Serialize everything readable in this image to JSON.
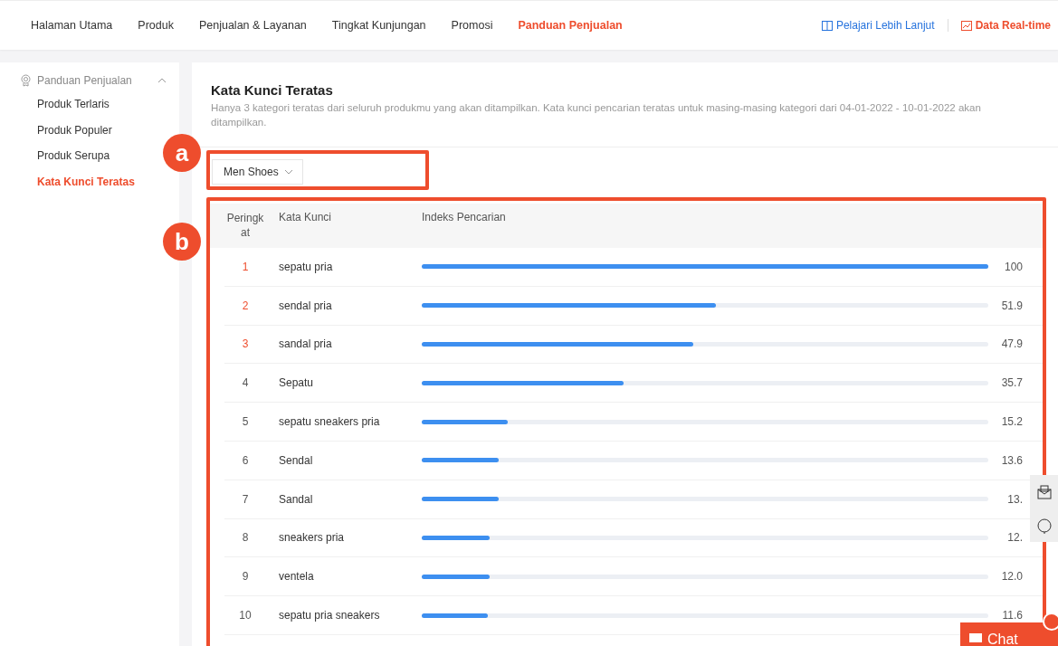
{
  "nav": {
    "items": [
      {
        "label": "Halaman Utama",
        "selected": false
      },
      {
        "label": "Produk",
        "selected": false
      },
      {
        "label": "Penjualan & Layanan",
        "selected": false
      },
      {
        "label": "Tingkat Kunjungan",
        "selected": false
      },
      {
        "label": "Promosi",
        "selected": false
      },
      {
        "label": "Panduan Penjualan",
        "selected": true
      }
    ],
    "links": [
      {
        "label": "Pelajari Lebih Lanjut",
        "kind": "book"
      },
      {
        "label": "Data Real-time",
        "kind": "chart"
      }
    ]
  },
  "sidebar": {
    "group": {
      "label": "Panduan Penjualan",
      "expanded": true
    },
    "items": [
      {
        "label": "Produk Terlaris",
        "selected": false
      },
      {
        "label": "Produk Populer",
        "selected": false
      },
      {
        "label": "Produk Serupa",
        "selected": false
      },
      {
        "label": "Kata Kunci Teratas",
        "selected": true
      }
    ]
  },
  "section": {
    "title": "Kata Kunci Teratas",
    "description": "Hanya 3 kategori teratas dari seluruh produkmu yang akan ditampilkan. Kata kunci pencarian teratas untuk masing-masing kategori dari 04-01-2022 - 10-01-2022 akan ditampilkan."
  },
  "annotations": [
    "a",
    "b"
  ],
  "category_dropdown": {
    "value": "Men Shoes"
  },
  "table": {
    "columns": [
      "Peringkat",
      "Kata Kunci",
      "Indeks Pencarian"
    ],
    "rows": [
      {
        "rank": "1",
        "keyword": "sepatu pria",
        "level": 1.0,
        "value": "100",
        "top": true
      },
      {
        "rank": "2",
        "keyword": "sendal pria",
        "level": 0.519,
        "value": "51.9",
        "top": true
      },
      {
        "rank": "3",
        "keyword": "sandal pria",
        "level": 0.479,
        "value": "47.9",
        "top": true
      },
      {
        "rank": "4",
        "keyword": "Sepatu",
        "level": 0.357,
        "value": "35.7",
        "top": false
      },
      {
        "rank": "5",
        "keyword": "sepatu sneakers pria",
        "level": 0.152,
        "value": "15.2",
        "top": false
      },
      {
        "rank": "6",
        "keyword": "Sendal",
        "level": 0.136,
        "value": "13.6",
        "top": false
      },
      {
        "rank": "7",
        "keyword": "Sandal",
        "level": 0.135,
        "value": "13.",
        "top": false
      },
      {
        "rank": "8",
        "keyword": "sneakers pria",
        "level": 0.12,
        "value": "12.",
        "top": false
      },
      {
        "rank": "9",
        "keyword": "ventela",
        "level": 0.12,
        "value": "12.0",
        "top": false
      },
      {
        "rank": "10",
        "keyword": "sepatu pria sneakers",
        "level": 0.116,
        "value": "11.6",
        "top": false
      }
    ]
  },
  "chat": {
    "label": "Chat"
  }
}
